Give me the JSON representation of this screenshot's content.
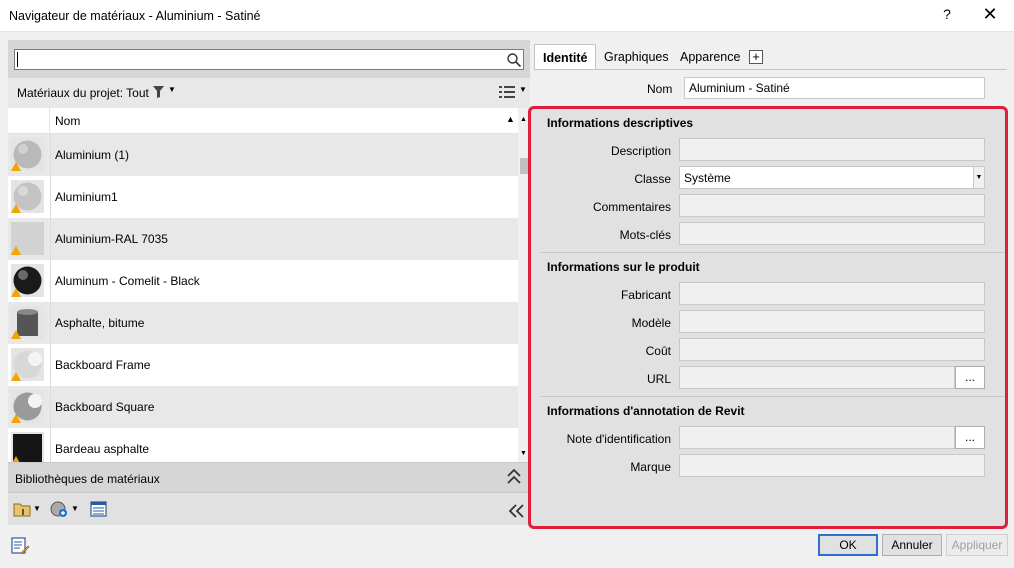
{
  "window": {
    "title": "Navigateur de matériaux - Aluminium - Satiné",
    "help_label": "?",
    "close_label": "✕"
  },
  "search": {
    "value": "",
    "placeholder": ""
  },
  "filter": {
    "label": "Matériaux du projet: Tout"
  },
  "list": {
    "column_name": "Nom",
    "items": [
      {
        "name": "Aluminium (1)",
        "swatch": "#b9b9b9",
        "shape": "sphere"
      },
      {
        "name": "Aluminium1",
        "swatch": "#c4c4c4",
        "shape": "sphere"
      },
      {
        "name": "Aluminium-RAL 7035",
        "swatch": "#d2d2d2",
        "shape": "flat"
      },
      {
        "name": "Aluminum - Comelit - Black",
        "swatch": "#1a1a1a",
        "shape": "sphere"
      },
      {
        "name": "Asphalte, bitume",
        "swatch": "#555555",
        "shape": "cylinder"
      },
      {
        "name": "Backboard Frame",
        "swatch": "#d8d8d8",
        "shape": "ring"
      },
      {
        "name": "Backboard Square",
        "swatch": "#9a9a9a",
        "shape": "ring"
      },
      {
        "name": "Bardeau asphalte",
        "swatch": "#151515",
        "shape": "cube"
      }
    ]
  },
  "libraries": {
    "label": "Bibliothèques de matériaux"
  },
  "tabs": [
    {
      "label": "Identité",
      "active": true
    },
    {
      "label": "Graphiques",
      "active": false
    },
    {
      "label": "Apparence",
      "active": false
    }
  ],
  "tab_add_label": "+",
  "name_field": {
    "label": "Nom",
    "value": "Aluminium - Satiné"
  },
  "sections": {
    "descriptive": {
      "title": "Informations descriptives",
      "description_label": "Description",
      "description_value": "",
      "class_label": "Classe",
      "class_value": "Système",
      "comments_label": "Commentaires",
      "comments_value": "",
      "keywords_label": "Mots-clés",
      "keywords_value": ""
    },
    "product": {
      "title": "Informations sur le produit",
      "manufacturer_label": "Fabricant",
      "manufacturer_value": "",
      "model_label": "Modèle",
      "model_value": "",
      "cost_label": "Coût",
      "cost_value": "",
      "url_label": "URL",
      "url_value": "",
      "browse_label": "..."
    },
    "revit": {
      "title": "Informations d'annotation de Revit",
      "keynote_label": "Note d'identification",
      "keynote_value": "",
      "browse_label": "...",
      "mark_label": "Marque",
      "mark_value": ""
    }
  },
  "buttons": {
    "ok": "OK",
    "cancel": "Annuler",
    "apply": "Appliquer"
  },
  "colors": {
    "highlight_border": "#e11d3c",
    "ok_border": "#2a6fd1",
    "warning": "#f0a500"
  }
}
